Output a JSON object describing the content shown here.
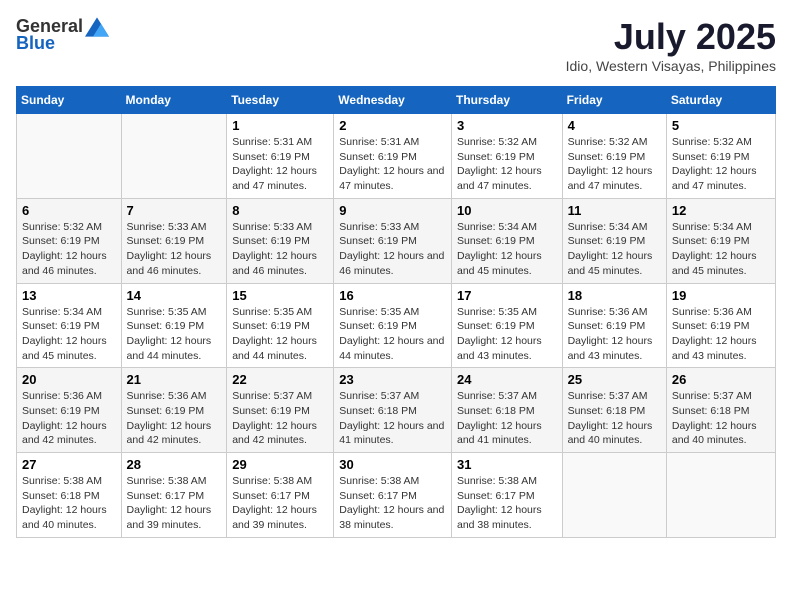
{
  "header": {
    "logo_general": "General",
    "logo_blue": "Blue",
    "month_title": "July 2025",
    "location": "Idio, Western Visayas, Philippines"
  },
  "weekdays": [
    "Sunday",
    "Monday",
    "Tuesday",
    "Wednesday",
    "Thursday",
    "Friday",
    "Saturday"
  ],
  "weeks": [
    [
      {
        "day": "",
        "detail": ""
      },
      {
        "day": "",
        "detail": ""
      },
      {
        "day": "1",
        "detail": "Sunrise: 5:31 AM\nSunset: 6:19 PM\nDaylight: 12 hours and 47 minutes."
      },
      {
        "day": "2",
        "detail": "Sunrise: 5:31 AM\nSunset: 6:19 PM\nDaylight: 12 hours and 47 minutes."
      },
      {
        "day": "3",
        "detail": "Sunrise: 5:32 AM\nSunset: 6:19 PM\nDaylight: 12 hours and 47 minutes."
      },
      {
        "day": "4",
        "detail": "Sunrise: 5:32 AM\nSunset: 6:19 PM\nDaylight: 12 hours and 47 minutes."
      },
      {
        "day": "5",
        "detail": "Sunrise: 5:32 AM\nSunset: 6:19 PM\nDaylight: 12 hours and 47 minutes."
      }
    ],
    [
      {
        "day": "6",
        "detail": "Sunrise: 5:32 AM\nSunset: 6:19 PM\nDaylight: 12 hours and 46 minutes."
      },
      {
        "day": "7",
        "detail": "Sunrise: 5:33 AM\nSunset: 6:19 PM\nDaylight: 12 hours and 46 minutes."
      },
      {
        "day": "8",
        "detail": "Sunrise: 5:33 AM\nSunset: 6:19 PM\nDaylight: 12 hours and 46 minutes."
      },
      {
        "day": "9",
        "detail": "Sunrise: 5:33 AM\nSunset: 6:19 PM\nDaylight: 12 hours and 46 minutes."
      },
      {
        "day": "10",
        "detail": "Sunrise: 5:34 AM\nSunset: 6:19 PM\nDaylight: 12 hours and 45 minutes."
      },
      {
        "day": "11",
        "detail": "Sunrise: 5:34 AM\nSunset: 6:19 PM\nDaylight: 12 hours and 45 minutes."
      },
      {
        "day": "12",
        "detail": "Sunrise: 5:34 AM\nSunset: 6:19 PM\nDaylight: 12 hours and 45 minutes."
      }
    ],
    [
      {
        "day": "13",
        "detail": "Sunrise: 5:34 AM\nSunset: 6:19 PM\nDaylight: 12 hours and 45 minutes."
      },
      {
        "day": "14",
        "detail": "Sunrise: 5:35 AM\nSunset: 6:19 PM\nDaylight: 12 hours and 44 minutes."
      },
      {
        "day": "15",
        "detail": "Sunrise: 5:35 AM\nSunset: 6:19 PM\nDaylight: 12 hours and 44 minutes."
      },
      {
        "day": "16",
        "detail": "Sunrise: 5:35 AM\nSunset: 6:19 PM\nDaylight: 12 hours and 44 minutes."
      },
      {
        "day": "17",
        "detail": "Sunrise: 5:35 AM\nSunset: 6:19 PM\nDaylight: 12 hours and 43 minutes."
      },
      {
        "day": "18",
        "detail": "Sunrise: 5:36 AM\nSunset: 6:19 PM\nDaylight: 12 hours and 43 minutes."
      },
      {
        "day": "19",
        "detail": "Sunrise: 5:36 AM\nSunset: 6:19 PM\nDaylight: 12 hours and 43 minutes."
      }
    ],
    [
      {
        "day": "20",
        "detail": "Sunrise: 5:36 AM\nSunset: 6:19 PM\nDaylight: 12 hours and 42 minutes."
      },
      {
        "day": "21",
        "detail": "Sunrise: 5:36 AM\nSunset: 6:19 PM\nDaylight: 12 hours and 42 minutes."
      },
      {
        "day": "22",
        "detail": "Sunrise: 5:37 AM\nSunset: 6:19 PM\nDaylight: 12 hours and 42 minutes."
      },
      {
        "day": "23",
        "detail": "Sunrise: 5:37 AM\nSunset: 6:18 PM\nDaylight: 12 hours and 41 minutes."
      },
      {
        "day": "24",
        "detail": "Sunrise: 5:37 AM\nSunset: 6:18 PM\nDaylight: 12 hours and 41 minutes."
      },
      {
        "day": "25",
        "detail": "Sunrise: 5:37 AM\nSunset: 6:18 PM\nDaylight: 12 hours and 40 minutes."
      },
      {
        "day": "26",
        "detail": "Sunrise: 5:37 AM\nSunset: 6:18 PM\nDaylight: 12 hours and 40 minutes."
      }
    ],
    [
      {
        "day": "27",
        "detail": "Sunrise: 5:38 AM\nSunset: 6:18 PM\nDaylight: 12 hours and 40 minutes."
      },
      {
        "day": "28",
        "detail": "Sunrise: 5:38 AM\nSunset: 6:17 PM\nDaylight: 12 hours and 39 minutes."
      },
      {
        "day": "29",
        "detail": "Sunrise: 5:38 AM\nSunset: 6:17 PM\nDaylight: 12 hours and 39 minutes."
      },
      {
        "day": "30",
        "detail": "Sunrise: 5:38 AM\nSunset: 6:17 PM\nDaylight: 12 hours and 38 minutes."
      },
      {
        "day": "31",
        "detail": "Sunrise: 5:38 AM\nSunset: 6:17 PM\nDaylight: 12 hours and 38 minutes."
      },
      {
        "day": "",
        "detail": ""
      },
      {
        "day": "",
        "detail": ""
      }
    ]
  ]
}
